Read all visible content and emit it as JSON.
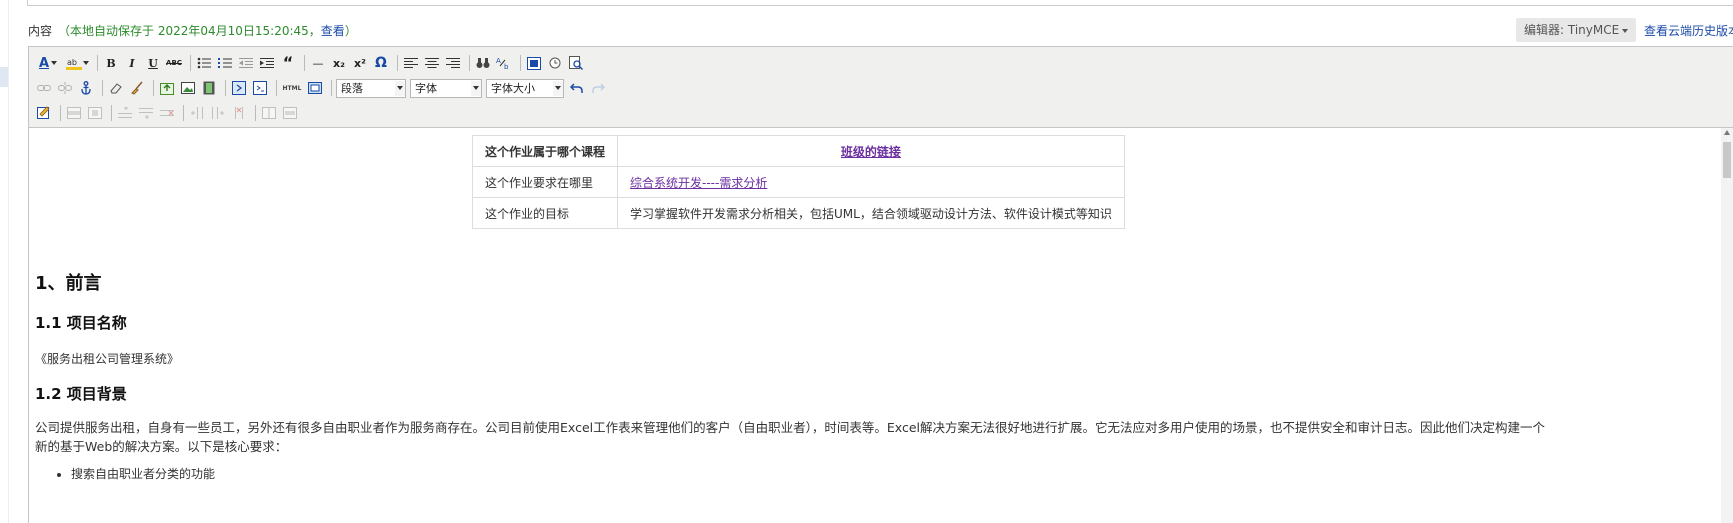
{
  "header": {
    "label": "内容",
    "autosave_prefix": "（本地自动保存于 2022年04月10日15:20:45，",
    "autosave_link": "查看",
    "autosave_suffix": "）",
    "editor_badge": "编辑器: TinyMCE",
    "cloud_history": "查看云端历史版本"
  },
  "toolbar": {
    "font_color": "A",
    "bold": "B",
    "italic": "I",
    "underline": "U",
    "strike": "ABC",
    "hr": "—",
    "subscript": "x₂",
    "superscript": "x²",
    "omega": "Ω",
    "quote": "“",
    "html_label": "HTML",
    "format_select": "段落",
    "font_select": "字体",
    "size_select": "字体大小"
  },
  "info_table": {
    "rows": [
      {
        "key": "这个作业属于哪个课程",
        "value": "班级的链接"
      },
      {
        "key": "这个作业要求在哪里",
        "value": "综合系统开发----需求分析"
      },
      {
        "key": "这个作业的目标",
        "value": "学习掌握软件开发需求分析相关，包括UML，结合领域驱动设计方法、软件设计模式等知识"
      }
    ]
  },
  "document": {
    "h1": "1、前言",
    "h2_name": "1.1 项目名称",
    "project_name": "《服务出租公司管理系统》",
    "h2_background": "1.2 项目背景",
    "background": "公司提供服务出租，自身有一些员工，另外还有很多自由职业者作为服务商存在。公司目前使用Excel工作表来管理他们的客户（自由职业者），时间表等。Excel解决方案无法很好地进行扩展。它无法应对多用户使用的场景，也不提供安全和审计日志。因此他们决定构建一个新的基于Web的解决方案。以下是核心要求：",
    "list": [
      "搜索自由职业者分类的功能"
    ]
  },
  "colors": {
    "autosave_green": "#2c8b2c",
    "link_blue": "#1a4aa8",
    "visited_purple": "#6b2fa0",
    "toolbar_bg": "#f0f0ee"
  }
}
